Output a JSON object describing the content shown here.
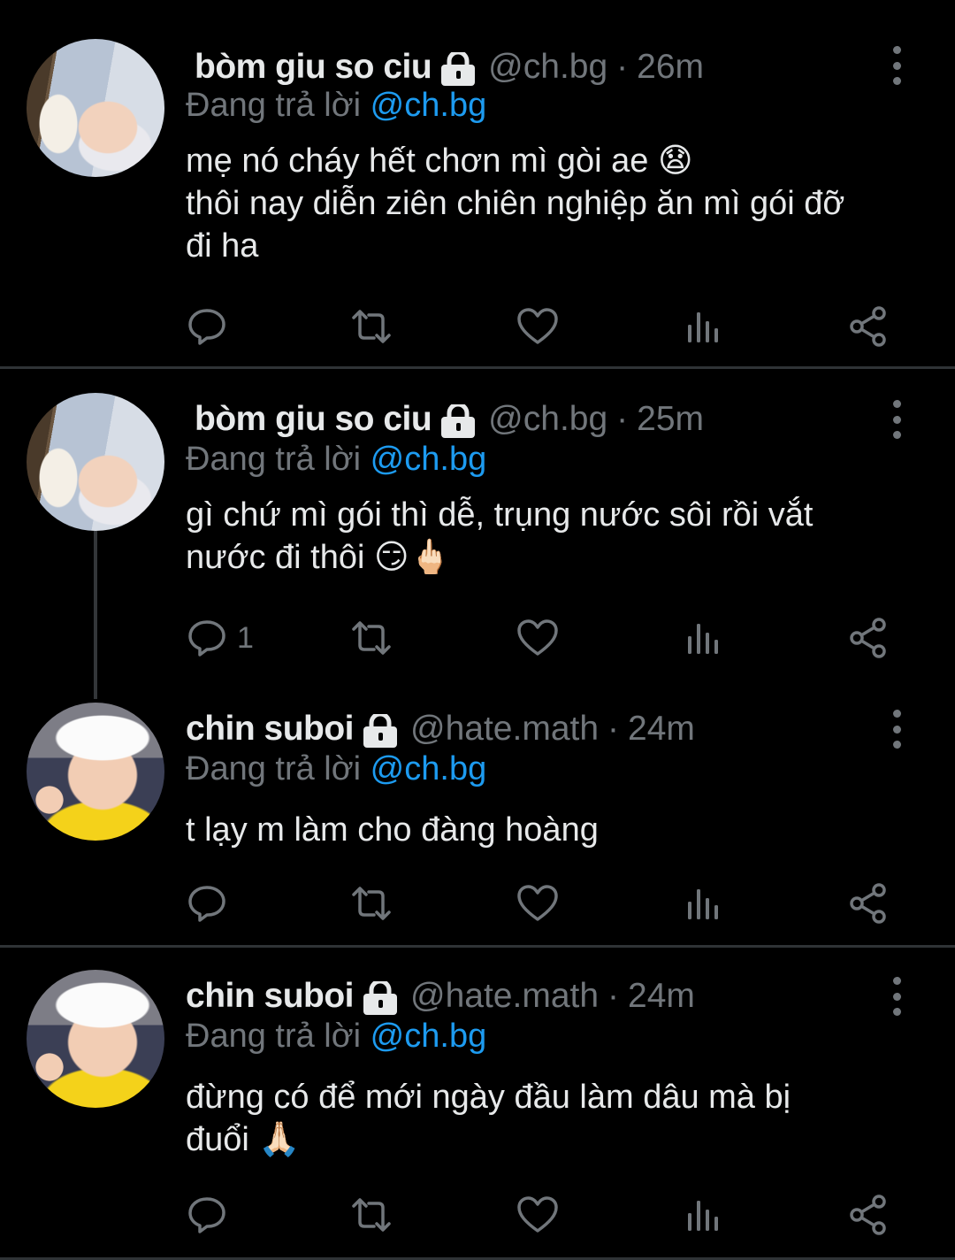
{
  "colors": {
    "background": "#000000",
    "text": "#e7e9ea",
    "secondary": "#71767b",
    "mention": "#1d9bf0",
    "divider": "#2f3336"
  },
  "tweets": [
    {
      "name": "bòm giu so ciu",
      "handle": "@ch.bg",
      "time": "26m",
      "reply_prefix": "Đang trả lời",
      "reply_to": "@ch.bg",
      "lines": [
        "mẹ nó cháy hết chơn mì gòi ae 😧",
        "thôi nay diễn ziên chiên nghiệp ăn mì gói đỡ",
        "đi ha"
      ],
      "reply_count": "",
      "avatar_icon": "sleeping-baby-avatar"
    },
    {
      "name": "bòm giu so ciu",
      "handle": "@ch.bg",
      "time": "25m",
      "reply_prefix": "Đang trả lời",
      "reply_to": "@ch.bg",
      "lines": [
        "gì chứ mì gói thì dễ, trụng nước sôi rồi vắt",
        "nước đi thôi 😏🖕🏻"
      ],
      "reply_count": "1",
      "avatar_icon": "sleeping-baby-avatar"
    },
    {
      "name": "chin suboi",
      "handle": "@hate.math",
      "time": "24m",
      "reply_prefix": "Đang trả lời",
      "reply_to": "@ch.bg",
      "lines": [
        "t lạy m làm cho đàng hoàng"
      ],
      "reply_count": "",
      "avatar_icon": "chef-kid-avatar"
    },
    {
      "name": "chin suboi",
      "handle": "@hate.math",
      "time": "24m",
      "reply_prefix": "Đang trả lời",
      "reply_to": "@ch.bg",
      "lines": [
        "đừng có để mới ngày đầu làm dâu mà bị",
        "đuổi 🙏🏻"
      ],
      "reply_count": "",
      "avatar_icon": "chef-kid-avatar"
    }
  ]
}
